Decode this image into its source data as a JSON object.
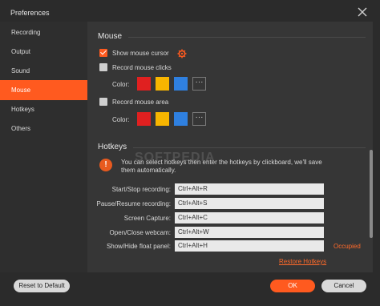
{
  "window": {
    "title": "Preferences"
  },
  "sidebar": {
    "items": [
      {
        "label": "Recording"
      },
      {
        "label": "Output"
      },
      {
        "label": "Sound"
      },
      {
        "label": "Mouse"
      },
      {
        "label": "Hotkeys"
      },
      {
        "label": "Others"
      }
    ],
    "active_index": 3
  },
  "mouse": {
    "title": "Mouse",
    "show_cursor": {
      "label": "Show mouse cursor",
      "checked": true
    },
    "record_clicks": {
      "label": "Record mouse clicks",
      "checked": false,
      "color_label": "Color:"
    },
    "record_area": {
      "label": "Record mouse area",
      "checked": false,
      "color_label": "Color:"
    },
    "swatches": [
      "#e02020",
      "#f7b500",
      "#2f80e0"
    ],
    "more_label": "···"
  },
  "hotkeys": {
    "title": "Hotkeys",
    "info_icon": "!",
    "info_text": "You can select hotkeys then enter the hotkeys by clickboard, we'll save them automatically.",
    "rows": [
      {
        "label": "Start/Stop recording:",
        "value": "Ctrl+Alt+R"
      },
      {
        "label": "Pause/Resume recording:",
        "value": "Ctrl+Alt+S"
      },
      {
        "label": "Screen Capture:",
        "value": "Ctrl+Alt+C"
      },
      {
        "label": "Open/Close webcam:",
        "value": "Ctrl+Alt+W"
      },
      {
        "label": "Show/Hide float panel:",
        "value": "Ctrl+Alt+H"
      }
    ],
    "occupied_label": "Occupied",
    "restore_label": "Restore Hotkeys"
  },
  "watermark": "SOFTPEDIA",
  "footer": {
    "reset_label": "Reset to Default",
    "ok_label": "OK",
    "cancel_label": "Cancel"
  },
  "colors": {
    "accent": "#ff5a1f",
    "background": "#2b2b2b",
    "panel": "#363636"
  }
}
